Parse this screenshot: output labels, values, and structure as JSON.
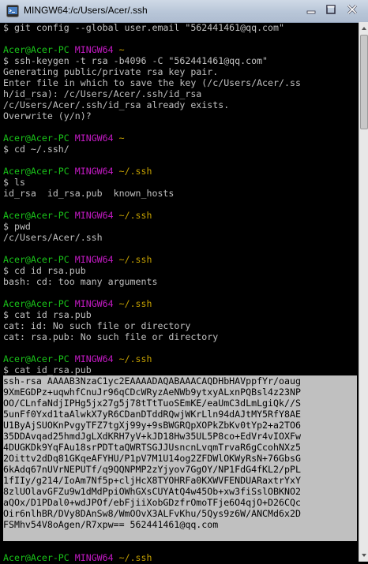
{
  "window": {
    "title": "MINGW64:/c/Users/Acer/.ssh"
  },
  "prompt": {
    "user_host": "Acer@Acer-PC",
    "shell": "MINGW64"
  },
  "colors": {
    "prompt_green": "#19c419",
    "shell_magenta": "#c41ac4",
    "path_yellow": "#c4a000",
    "text": "#c0c0c0",
    "selection_bg": "#c0c0c0"
  },
  "lines": [
    {
      "t": "cmd",
      "text": "$ git config --global user.email \"562441461@qq.com\""
    },
    {
      "t": "blank"
    },
    {
      "t": "prompt",
      "path": "~"
    },
    {
      "t": "cmd",
      "text": "$ ssh-keygen -t rsa -b4096 -C \"562441461@qq.com\""
    },
    {
      "t": "out",
      "text": "Generating public/private rsa key pair."
    },
    {
      "t": "out",
      "text": "Enter file in which to save the key (/c/Users/Acer/.ss"
    },
    {
      "t": "out",
      "text": "h/id_rsa): /c/Users/Acer/.ssh/id_rsa"
    },
    {
      "t": "out",
      "text": "/c/Users/Acer/.ssh/id_rsa already exists."
    },
    {
      "t": "out",
      "text": "Overwrite (y/n)?"
    },
    {
      "t": "blank"
    },
    {
      "t": "prompt",
      "path": "~"
    },
    {
      "t": "cmd",
      "text": "$ cd ~/.ssh/"
    },
    {
      "t": "blank"
    },
    {
      "t": "prompt",
      "path": "~/.ssh"
    },
    {
      "t": "cmd",
      "text": "$ ls"
    },
    {
      "t": "out",
      "text": "id_rsa  id_rsa.pub  known_hosts"
    },
    {
      "t": "blank"
    },
    {
      "t": "prompt",
      "path": "~/.ssh"
    },
    {
      "t": "cmd",
      "text": "$ pwd"
    },
    {
      "t": "out",
      "text": "/c/Users/Acer/.ssh"
    },
    {
      "t": "blank"
    },
    {
      "t": "prompt",
      "path": "~/.ssh"
    },
    {
      "t": "cmd",
      "text": "$ cd id rsa.pub"
    },
    {
      "t": "out",
      "text": "bash: cd: too many arguments"
    },
    {
      "t": "blank"
    },
    {
      "t": "prompt",
      "path": "~/.ssh"
    },
    {
      "t": "cmd",
      "text": "$ cat id rsa.pub"
    },
    {
      "t": "out",
      "text": "cat: id: No such file or directory"
    },
    {
      "t": "out",
      "text": "cat: rsa.pub: No such file or directory"
    },
    {
      "t": "blank"
    },
    {
      "t": "prompt",
      "path": "~/.ssh"
    },
    {
      "t": "cmd",
      "text": "$ cat id_rsa.pub"
    },
    {
      "t": "sel",
      "text": "ssh-rsa AAAAB3NzaC1yc2EAAAADAQABAAACAQDHbHAVppfYr/oaug"
    },
    {
      "t": "sel",
      "text": "9XmEGDPz+uqwhfCnuJr96qCDcWRyzAeNWb9ytxyALxnPQBsl4z23NP"
    },
    {
      "t": "sel",
      "text": "OO/CLnfaNdjIPHg5jx27g5j78tTtTuoSEmKE/eaUmC3dLmLgiQk//S"
    },
    {
      "t": "sel",
      "text": "5unFf0Yxd1taAlwkX7yR6CDanDTddRQwjWKrLln94dAJtMY5RfY8AE"
    },
    {
      "t": "sel",
      "text": "U1ByAjSUOKnPvgyTFZ7tgXj99y+9sBWGRQpXOPkZbKv0tYp2+a2TO6"
    },
    {
      "t": "sel",
      "text": "35DDAvqad25hmdJgLXdKRH7yV+kJD18Hw35UL5P8co+EdVr4vIOXFw"
    },
    {
      "t": "sel",
      "text": "4DUGKDk9YqFAu18srPDTtaQWRTSGJJUsncnLvqmTrvaR6gCcohNXz5"
    },
    {
      "t": "sel",
      "text": "2Oittv2dDq81GKqeAFYHU/P1pV7M1U14og2ZFDWlOKWyRsN+76GbsG"
    },
    {
      "t": "sel",
      "text": "6kAdq67nUVrNEPUTf/q9QQNPMP2zYjyov7GgOY/NP1FdG4fKL2/pPL"
    },
    {
      "t": "sel",
      "text": "1fIIy/g214/IoAm7Nf5p+cljHcX8TYOHRFa0KXWVFENDUARaxtrYxY"
    },
    {
      "t": "sel",
      "text": "8zlUOlavGFZu9w1dMdPpiOWhGXsCUYAtQ4w45Ob+xw3fiSslOBKNO2"
    },
    {
      "t": "sel",
      "text": "aQOx/D1PDal0+wdJPOf/ebFjiiXobGDzfrOmoTFje6O4qjO+D26CQc"
    },
    {
      "t": "sel",
      "text": "Oir6nlhBR/DVy8DAnSw8/WmOOvX3ALFvKhu/5Qys9z6W/ANCMd6x2D"
    },
    {
      "t": "sel",
      "text": "FSMhv54V8oAgen/R7xpw== 562441461@qq.com"
    },
    {
      "t": "sel",
      "text": " "
    },
    {
      "t": "blank"
    },
    {
      "t": "prompt",
      "path": "~/.ssh"
    },
    {
      "t": "cmd",
      "text": "$"
    }
  ]
}
